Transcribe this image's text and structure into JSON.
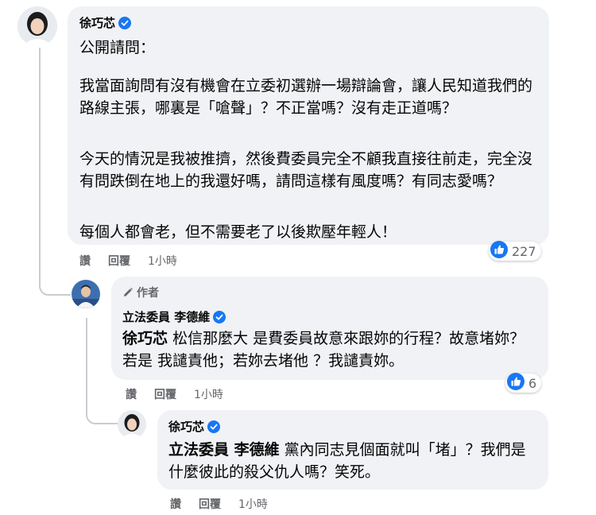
{
  "comment1": {
    "author": "徐巧芯",
    "text": [
      "公開請問：",
      "我當面詢問有沒有機會在立委初選辦一場辯論會，讓人民知道我們的路線主張，哪裏是「嗆聲」？不正當嗎？沒有走正道嗎？",
      "今天的情況是我被推擠，然後費委員完全不顧我直接往前走，完全沒有問跌倒在地上的我還好嗎，請問這樣有風度嗎？有同志愛嗎？",
      "每個人都會老，但不需要老了以後欺壓年輕人！"
    ],
    "actions": {
      "like": "讚",
      "reply": "回覆",
      "time": "1小時"
    },
    "reaction_count": "227"
  },
  "reply1": {
    "badge": "作者",
    "author": "立法委員 李德維",
    "mention": "徐巧芯",
    "text": "松信那麼大 是費委員故意來跟妳的行程？故意堵妳？若是 我譴責他；若妳去堵他 ？我譴責妳。",
    "actions": {
      "like": "讚",
      "reply": "回覆",
      "time": "1小時"
    },
    "reaction_count": "6"
  },
  "reply2": {
    "author": "徐巧芯",
    "mention": "立法委員 李德維",
    "text": "黨內同志見個面就叫「堵」？我們是什麼彼此的殺父仇人嗎？笑死。",
    "actions": {
      "like": "讚",
      "reply": "回覆",
      "time": "1小時"
    }
  },
  "colors": {
    "bubble": "#f0f2f5",
    "like_blue": "#1877f2",
    "secondary_text": "#65676b"
  }
}
